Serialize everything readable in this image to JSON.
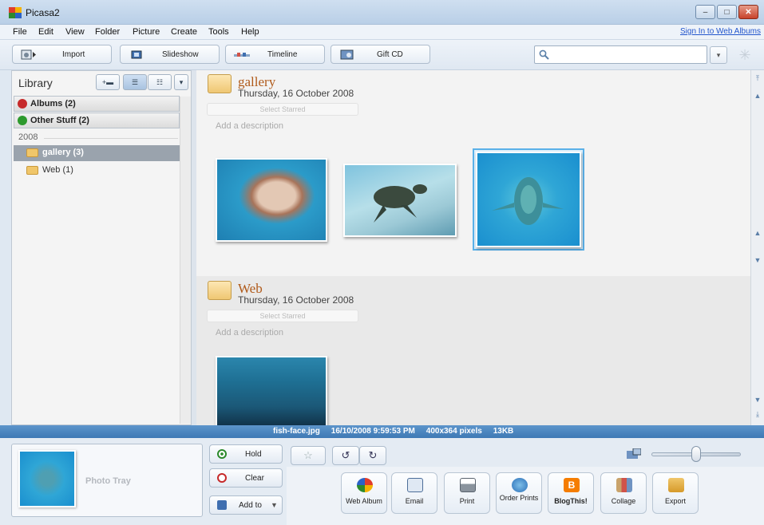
{
  "window": {
    "title": "Picasa2",
    "min": "–",
    "max": "□",
    "close": "✕"
  },
  "menu": {
    "items": [
      "File",
      "Edit",
      "View",
      "Folder",
      "Picture",
      "Create",
      "Tools",
      "Help"
    ],
    "signin": "Sign In to Web Albums"
  },
  "toolbar": {
    "import": "Import",
    "slideshow": "Slideshow",
    "timeline": "Timeline",
    "giftcd": "Gift CD",
    "search_value": ""
  },
  "library": {
    "title": "Library",
    "groups": [
      {
        "label": "Albums (2)",
        "expanded": false
      },
      {
        "label": "Other Stuff (2)",
        "expanded": true
      }
    ],
    "year": "2008",
    "folders": [
      {
        "label": "gallery (3)",
        "selected": true
      },
      {
        "label": "Web (1)",
        "selected": false
      }
    ]
  },
  "sections": [
    {
      "name": "gallery",
      "date": "Thursday, 16 October 2008",
      "starred": "Select Starred",
      "description": "Add a description"
    },
    {
      "name": "Web",
      "date": "Thursday, 16 October 2008",
      "starred": "Select Starred",
      "description": "Add a description"
    }
  ],
  "status": {
    "text": "fish-face.jpg     16/10/2008 9:59:53 PM     400x364 pixels     13KB"
  },
  "tray": {
    "label": "Photo Tray",
    "hold": "Hold",
    "clear": "Clear",
    "addto": "Add to"
  },
  "actions": [
    "Web Album",
    "Email",
    "Print",
    "Order Prints",
    "BlogThis!",
    "Collage",
    "Export"
  ],
  "colors": {
    "status_bar": "#4a86c1",
    "section_title": "#b05a1a",
    "selected_folder": "#9aa3ad"
  }
}
